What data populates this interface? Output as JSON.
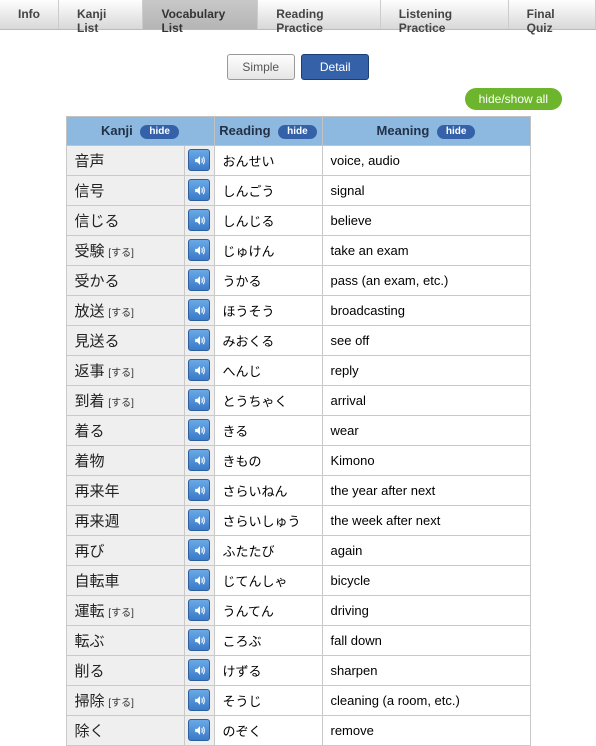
{
  "tabs": [
    {
      "label": "Info",
      "active": false
    },
    {
      "label": "Kanji List",
      "active": false
    },
    {
      "label": "Vocabulary List",
      "active": true
    },
    {
      "label": "Reading Practice",
      "active": false
    },
    {
      "label": "Listening Practice",
      "active": false
    },
    {
      "label": "Final Quiz",
      "active": false
    }
  ],
  "mode": {
    "simple": "Simple",
    "detail": "Detail"
  },
  "hideShowAll": "hide/show all",
  "columns": {
    "kanji": "Kanji",
    "reading": "Reading",
    "meaning": "Meaning",
    "hide": "hide"
  },
  "rows": [
    {
      "kanji": "音声",
      "suffix": "",
      "reading": "おんせい",
      "meaning": "voice, audio"
    },
    {
      "kanji": "信号",
      "suffix": "",
      "reading": "しんごう",
      "meaning": "signal"
    },
    {
      "kanji": "信じる",
      "suffix": "",
      "reading": "しんじる",
      "meaning": "believe"
    },
    {
      "kanji": "受験",
      "suffix": "[する]",
      "reading": "じゅけん",
      "meaning": "take an exam"
    },
    {
      "kanji": "受かる",
      "suffix": "",
      "reading": "うかる",
      "meaning": "pass (an exam, etc.)"
    },
    {
      "kanji": "放送",
      "suffix": "[する]",
      "reading": "ほうそう",
      "meaning": "broadcasting"
    },
    {
      "kanji": "見送る",
      "suffix": "",
      "reading": "みおくる",
      "meaning": "see off"
    },
    {
      "kanji": "返事",
      "suffix": "[する]",
      "reading": "へんじ",
      "meaning": "reply"
    },
    {
      "kanji": "到着",
      "suffix": "[する]",
      "reading": "とうちゃく",
      "meaning": "arrival"
    },
    {
      "kanji": "着る",
      "suffix": "",
      "reading": "きる",
      "meaning": "wear"
    },
    {
      "kanji": "着物",
      "suffix": "",
      "reading": "きもの",
      "meaning": "Kimono"
    },
    {
      "kanji": "再来年",
      "suffix": "",
      "reading": "さらいねん",
      "meaning": "the year after next"
    },
    {
      "kanji": "再来週",
      "suffix": "",
      "reading": "さらいしゅう",
      "meaning": "the week after next"
    },
    {
      "kanji": "再び",
      "suffix": "",
      "reading": "ふたたび",
      "meaning": "again"
    },
    {
      "kanji": "自転車",
      "suffix": "",
      "reading": "じてんしゃ",
      "meaning": "bicycle"
    },
    {
      "kanji": "運転",
      "suffix": "[する]",
      "reading": "うんてん",
      "meaning": "driving"
    },
    {
      "kanji": "転ぶ",
      "suffix": "",
      "reading": "ころぶ",
      "meaning": "fall down"
    },
    {
      "kanji": "削る",
      "suffix": "",
      "reading": "けずる",
      "meaning": "sharpen"
    },
    {
      "kanji": "掃除",
      "suffix": "[する]",
      "reading": "そうじ",
      "meaning": "cleaning (a room, etc.)"
    },
    {
      "kanji": "除く",
      "suffix": "",
      "reading": "のぞく",
      "meaning": "remove"
    }
  ]
}
